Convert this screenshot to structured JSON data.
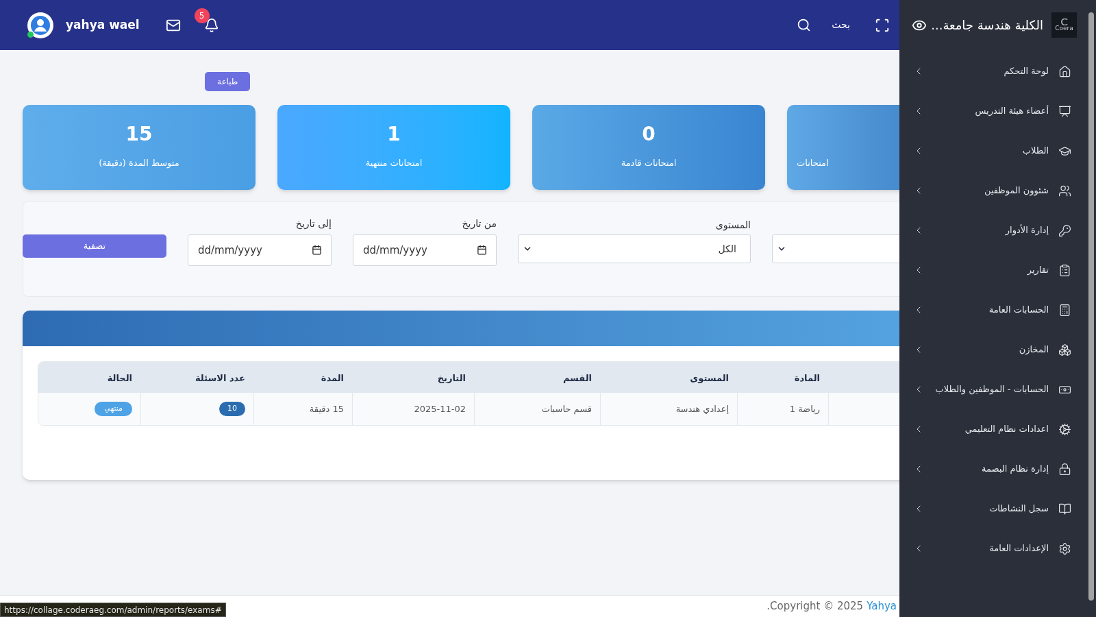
{
  "header": {
    "user_name": "yahya wael",
    "notification_count": "5",
    "search_label": "بحث"
  },
  "sidebar": {
    "logo_text": "Coera",
    "title": "الكلية هندسة جامعة...",
    "items": [
      {
        "label": "لوحة التحكم"
      },
      {
        "label": "أعضاء هيئة التدريس"
      },
      {
        "label": "الطلاب"
      },
      {
        "label": "شئوون الموظفين"
      },
      {
        "label": "إدارة الأدوار"
      },
      {
        "label": "تقارير"
      },
      {
        "label": "الحسابات العامة"
      },
      {
        "label": "المخازن"
      },
      {
        "label": "الحسابات - الموظفين والطلاب"
      },
      {
        "label": "اعدادات نظام التعليمي"
      },
      {
        "label": "إدارة نظام البصمة"
      },
      {
        "label": "سجل النشاطات"
      },
      {
        "label": "الإعدادات العامة"
      }
    ]
  },
  "print_button": "طباعة",
  "stats": [
    {
      "label": "امتحانات"
    },
    {
      "value": "0",
      "label": "امتحانات قادمة"
    },
    {
      "value": "1",
      "label": "امتحانات منتهية"
    },
    {
      "value": "15",
      "label": "متوسط المدة (دقيقة)"
    }
  ],
  "filters": [
    {
      "kind": "select"
    },
    {
      "kind": "select",
      "label": "المستوى",
      "value": "الكل"
    },
    {
      "kind": "date",
      "label": "من تاريخ",
      "placeholder": "dd/mm/yyyy"
    },
    {
      "kind": "date",
      "label": "إلى تاريخ",
      "placeholder": "dd/mm/yyyy"
    }
  ],
  "filter_button": "تصفية",
  "table": {
    "columns": [
      "المادة",
      "المستوى",
      "القسم",
      "التاريخ",
      "المدة",
      "عدد الاسئلة",
      "الحالة"
    ],
    "rows": [
      {
        "cells": [
          {
            "kind": "text",
            "text": "رياضة 1"
          },
          {
            "kind": "text",
            "text": "إعدادي هندسة"
          },
          {
            "kind": "text",
            "text": "قسم حاسبات"
          },
          {
            "kind": "text",
            "text": "2025-11-02"
          },
          {
            "kind": "text",
            "text": "15 دقيقة"
          },
          {
            "kind": "count",
            "text": "10"
          },
          {
            "kind": "status",
            "text": "منتهي"
          }
        ]
      }
    ]
  },
  "footer": {
    "text": "Copyright © 2025",
    "link": "Yahya",
    "end": "."
  },
  "status_url": "https://collage.coderaeg.com/admin/reports/exams#"
}
